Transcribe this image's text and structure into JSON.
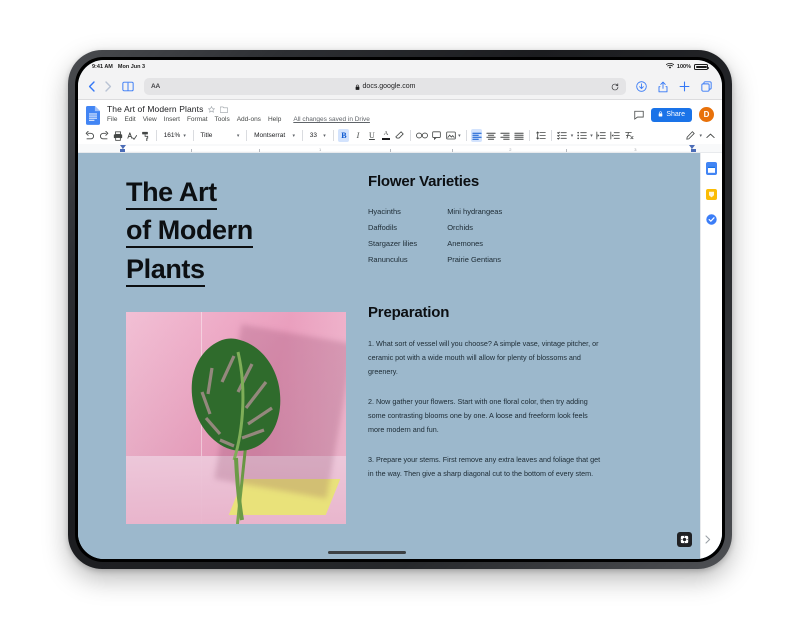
{
  "device": {
    "status_bar": {
      "time": "9:41 AM",
      "date": "Mon Jun 3",
      "wifi_icon": "wifi-icon",
      "battery_percent": "100%",
      "battery_icon": "battery-full-icon"
    }
  },
  "browser": {
    "back_icon": "chevron-left-icon",
    "forward_icon": "chevron-right-icon",
    "bookmarks_icon": "book-icon",
    "reader_label": "AA",
    "lock_icon": "lock-icon",
    "url": "docs.google.com",
    "reload_icon": "reload-icon",
    "download_icon": "download-icon",
    "share_icon": "share-icon",
    "new_tab_icon": "plus-icon",
    "tabs_icon": "tabs-icon"
  },
  "docs": {
    "app_icon": "google-docs-icon",
    "doc_title": "The Art of Modern Plants",
    "star_icon": "star-outline-icon",
    "folder_icon": "folder-move-icon",
    "menus": [
      "File",
      "Edit",
      "View",
      "Insert",
      "Format",
      "Tools",
      "Add-ons",
      "Help"
    ],
    "save_status": "All changes saved in Drive",
    "comment_icon": "comment-icon",
    "share_button": {
      "label": "Share",
      "icon": "lock-icon",
      "color": "#1a73e8"
    },
    "avatar": {
      "initial": "D",
      "color": "#e8710a"
    }
  },
  "toolbar": {
    "undo_icon": "undo-icon",
    "redo_icon": "redo-icon",
    "print_icon": "print-icon",
    "spellcheck_icon": "spellcheck-icon",
    "paint_format_icon": "paint-format-icon",
    "zoom_value": "161%",
    "style_value": "Title",
    "font_value": "Montserrat",
    "size_value": "33",
    "bold_icon": "bold-icon",
    "bold_active": true,
    "italic_icon": "italic-icon",
    "underline_icon": "underline-icon",
    "text_color_icon": "text-color-icon",
    "highlight_icon": "highlight-icon",
    "link_icon": "link-icon",
    "add_comment_icon": "add-comment-icon",
    "insert_image_icon": "insert-image-icon",
    "align_left_icon": "align-left-icon",
    "align_center_icon": "align-center-icon",
    "align_right_icon": "align-right-icon",
    "align_justify_icon": "align-justify-icon",
    "line_spacing_icon": "line-spacing-icon",
    "checklist_icon": "checklist-icon",
    "bulleted_list_icon": "bulleted-list-icon",
    "numbered_list_icon": "numbered-list-icon",
    "decrease_indent_icon": "decrease-indent-icon",
    "increase_indent_icon": "increase-indent-icon",
    "clear_format_icon": "clear-formatting-icon",
    "edit_mode_icon": "pencil-icon",
    "collapse_icon": "chevron-up-icon",
    "ruler_numbers": [
      "1",
      "2",
      "3",
      "4"
    ]
  },
  "document": {
    "title_lines": [
      "The Art",
      "of Modern",
      "Plants"
    ],
    "image": {
      "name": "monstera-leaf-photo",
      "alt": "Monstera leaf on pink background with yellow block"
    },
    "sections": [
      {
        "heading": "Flower Varieties",
        "columns": [
          [
            "Hyacinths",
            "Daffodils",
            "Stargazer lilies",
            "Ranunculus"
          ],
          [
            "Mini hydrangeas",
            "Orchids",
            "Anemones",
            "Prairie Gentians"
          ]
        ]
      },
      {
        "heading": "Preparation",
        "paragraphs": [
          "1. What sort of vessel will you choose? A simple vase, vintage pitcher, or ceramic pot with a wide mouth will allow for plenty of blossoms and greenery.",
          "2. Now gather your flowers. Start with one floral color, then try adding some contrasting blooms one by one. A loose and freeform look feels more modern and fun.",
          "3. Prepare your stems. First remove any extra leaves and foliage that get in the way. Then give a sharp diagonal cut to the bottom of every stem."
        ]
      }
    ],
    "page_background": "#9cb8cc",
    "text_color": "#1c2a33"
  },
  "side_panel": {
    "items": [
      {
        "name": "calendar-icon",
        "color": "#4285f4"
      },
      {
        "name": "keep-icon",
        "color": "#fbbc04"
      },
      {
        "name": "tasks-icon",
        "color": "#3b7df7"
      }
    ]
  },
  "footer": {
    "explore_icon": "explore-icon",
    "expand_icon": "chevron-right-icon",
    "scrollbar": "horizontal-scrollbar"
  }
}
